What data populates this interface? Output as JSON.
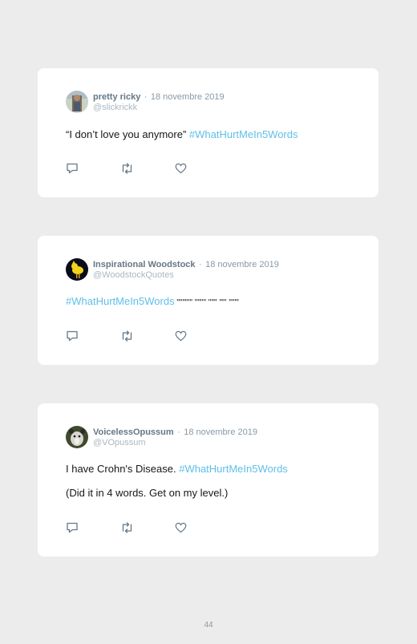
{
  "tweets": [
    {
      "name": "pretty ricky",
      "separator": "·",
      "date": "18 novembre 2019",
      "handle": "@slickrickk",
      "text_before": "“I don’t love you anymore” ",
      "hashtag": "#WhatHurtMeIn5Words",
      "text_after": "",
      "second_line": ""
    },
    {
      "name": "Inspirational Woodstock",
      "separator": "·",
      "date": "18 novembre 2019",
      "handle": "@WoodstockQuotes",
      "text_before": "",
      "hashtag": "#WhatHurtMeIn5Words",
      "text_after": " \"\"\"\"\"' \"\"\"\" '\"\"' \"\"' '\"\"\"",
      "second_line": ""
    },
    {
      "name": "VoicelessOpussum",
      "separator": "·",
      "date": "18 novembre 2019",
      "handle": "@VOpussum",
      "text_before": "I have Crohn's Disease. ",
      "hashtag": "#WhatHurtMeIn5Words",
      "text_after": "",
      "second_line": "(Did it in 4 words. Get on my level.)"
    }
  ],
  "icons": [
    "reply-icon",
    "retweet-icon",
    "like-icon"
  ],
  "page_number": "44",
  "colors": {
    "hashtag": "#5fbfe8",
    "name": "#657786",
    "icon": "#657786"
  }
}
